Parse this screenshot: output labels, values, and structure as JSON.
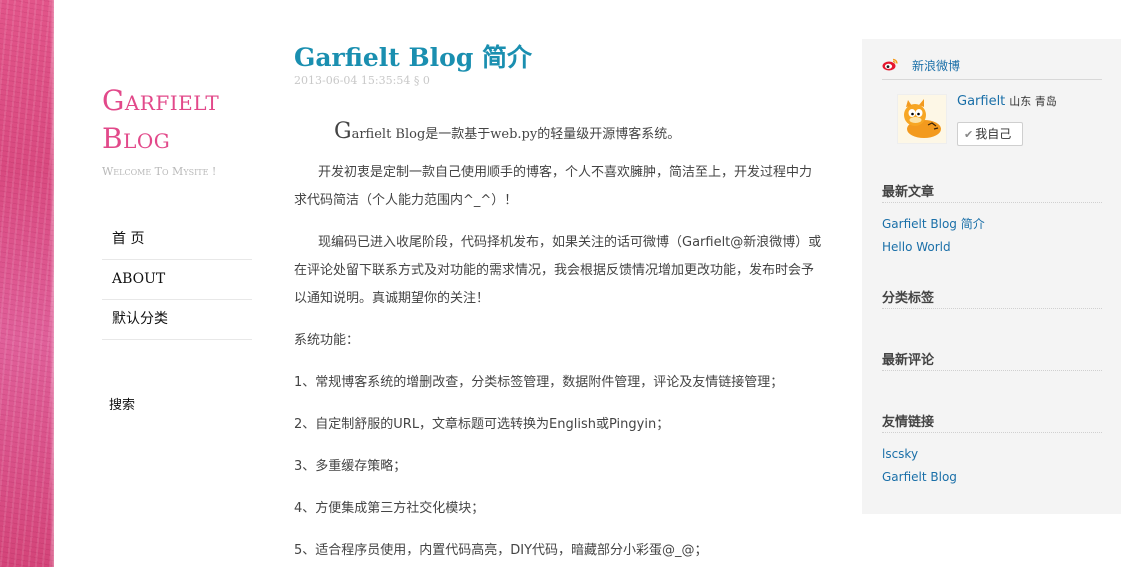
{
  "site": {
    "title_line1": "Garfielt",
    "title_line2": "Blog",
    "tagline": "Welcome To Mysite !"
  },
  "nav": {
    "items": [
      {
        "label": "首 页"
      },
      {
        "label": "ABOUT"
      },
      {
        "label": "默认分类"
      }
    ],
    "search_label": "搜索"
  },
  "post": {
    "title": "Garfielt Blog 简介",
    "meta": "2013-06-04 15:35:54 § 0",
    "intro_dropcap": "G",
    "intro_rest": "arfielt Blog是一款基于web.py的轻量级开源博客系统。",
    "paragraphs": [
      "开发初衷是定制一款自己使用顺手的博客，个人不喜欢臃肿，简洁至上，开发过程中力求代码简洁（个人能力范围内^_^）！",
      "现编码已进入收尾阶段，代码择机发布，如果关注的话可微博（Garfielt@新浪微博）或在评论处留下联系方式及对功能的需求情况，我会根据反馈情况增加更改功能，发布时会予以通知说明。真诚期望你的关注！"
    ],
    "features_heading": "系统功能：",
    "features": [
      "1、常规博客系统的增删改查，分类标签管理，数据附件管理，评论及友情链接管理；",
      "2、自定制舒服的URL，文章标题可选转换为English或Pingyin；",
      "3、多重缓存策略；",
      "4、方便集成第三方社交化模块；",
      "5、适合程序员使用，内置代码高亮，DIY代码，暗藏部分小彩蛋@_@；"
    ]
  },
  "sidebar": {
    "weibo": {
      "heading": "新浪微博",
      "user_name": "Garfielt",
      "location": "山东 青岛",
      "follow_label": "我自己"
    },
    "recent_posts": {
      "title": "最新文章",
      "items": [
        "Garfielt Blog 简介",
        "Hello World"
      ]
    },
    "tags": {
      "title": "分类标签"
    },
    "recent_comments": {
      "title": "最新评论"
    },
    "links": {
      "title": "友情链接",
      "items": [
        "lscsky",
        "Garfielt Blog"
      ]
    }
  },
  "colors": {
    "accent_pink": "#e2498a",
    "title_blue": "#1a8fb0",
    "link_blue": "#1a6fa8",
    "sidebar_bg": "#f4f4f4"
  }
}
